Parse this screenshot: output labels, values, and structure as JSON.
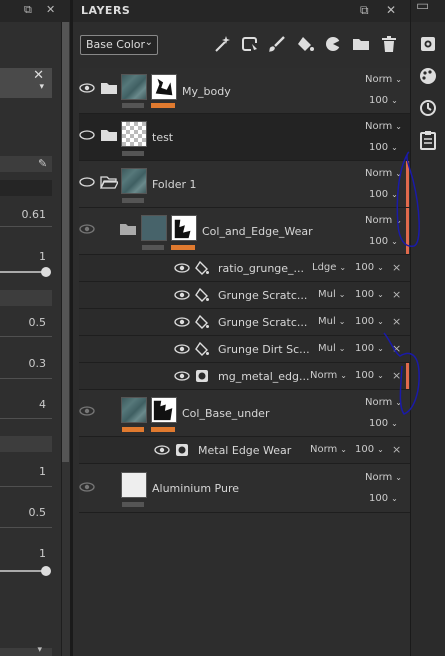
{
  "panel": {
    "title": "LAYERS",
    "filter_value": "Base Color"
  },
  "left_panel": {
    "values": [
      "0.61",
      "1",
      "0.5",
      "0.3",
      "4",
      "1",
      "0.5",
      "1"
    ],
    "close_glyph": "✕"
  },
  "layers": [
    {
      "name": "My_body",
      "blend": "Norm",
      "opacity": "100"
    },
    {
      "name": "test",
      "blend": "Norm",
      "opacity": "100"
    },
    {
      "name": "Folder 1",
      "blend": "Norm",
      "opacity": "100"
    },
    {
      "name": "Col_and_Edge_Wear",
      "blend": "Norm",
      "opacity": "100"
    },
    {
      "name": "ratio_grunge_...",
      "blend": "Ldge",
      "opacity": "100"
    },
    {
      "name": "Grunge Scratc...",
      "blend": "Mul",
      "opacity": "100"
    },
    {
      "name": "Grunge Scratc...",
      "blend": "Mul",
      "opacity": "100"
    },
    {
      "name": "Grunge Dirt Sc...",
      "blend": "Mul",
      "opacity": "100"
    },
    {
      "name": "mg_metal_edg...",
      "blend": "Norm",
      "opacity": "100"
    },
    {
      "name": "Col_Base_under",
      "blend": "Norm",
      "opacity": "100"
    },
    {
      "name": "Metal Edge Wear",
      "blend": "Norm",
      "opacity": "100"
    },
    {
      "name": "Aluminium Pure",
      "blend": "Norm",
      "opacity": "100"
    }
  ],
  "colors": {
    "accent": "#e07a2f",
    "strip": "#e06a4c",
    "annotation": "#1a1aa8"
  },
  "icons": [
    "magic-wand-icon",
    "paint-mask-icon",
    "brush-icon",
    "fill-bucket-icon",
    "smart-material-icon",
    "folder-icon",
    "trash-icon",
    "settings-icon",
    "palette-icon",
    "history-icon",
    "clipboard-icon"
  ]
}
